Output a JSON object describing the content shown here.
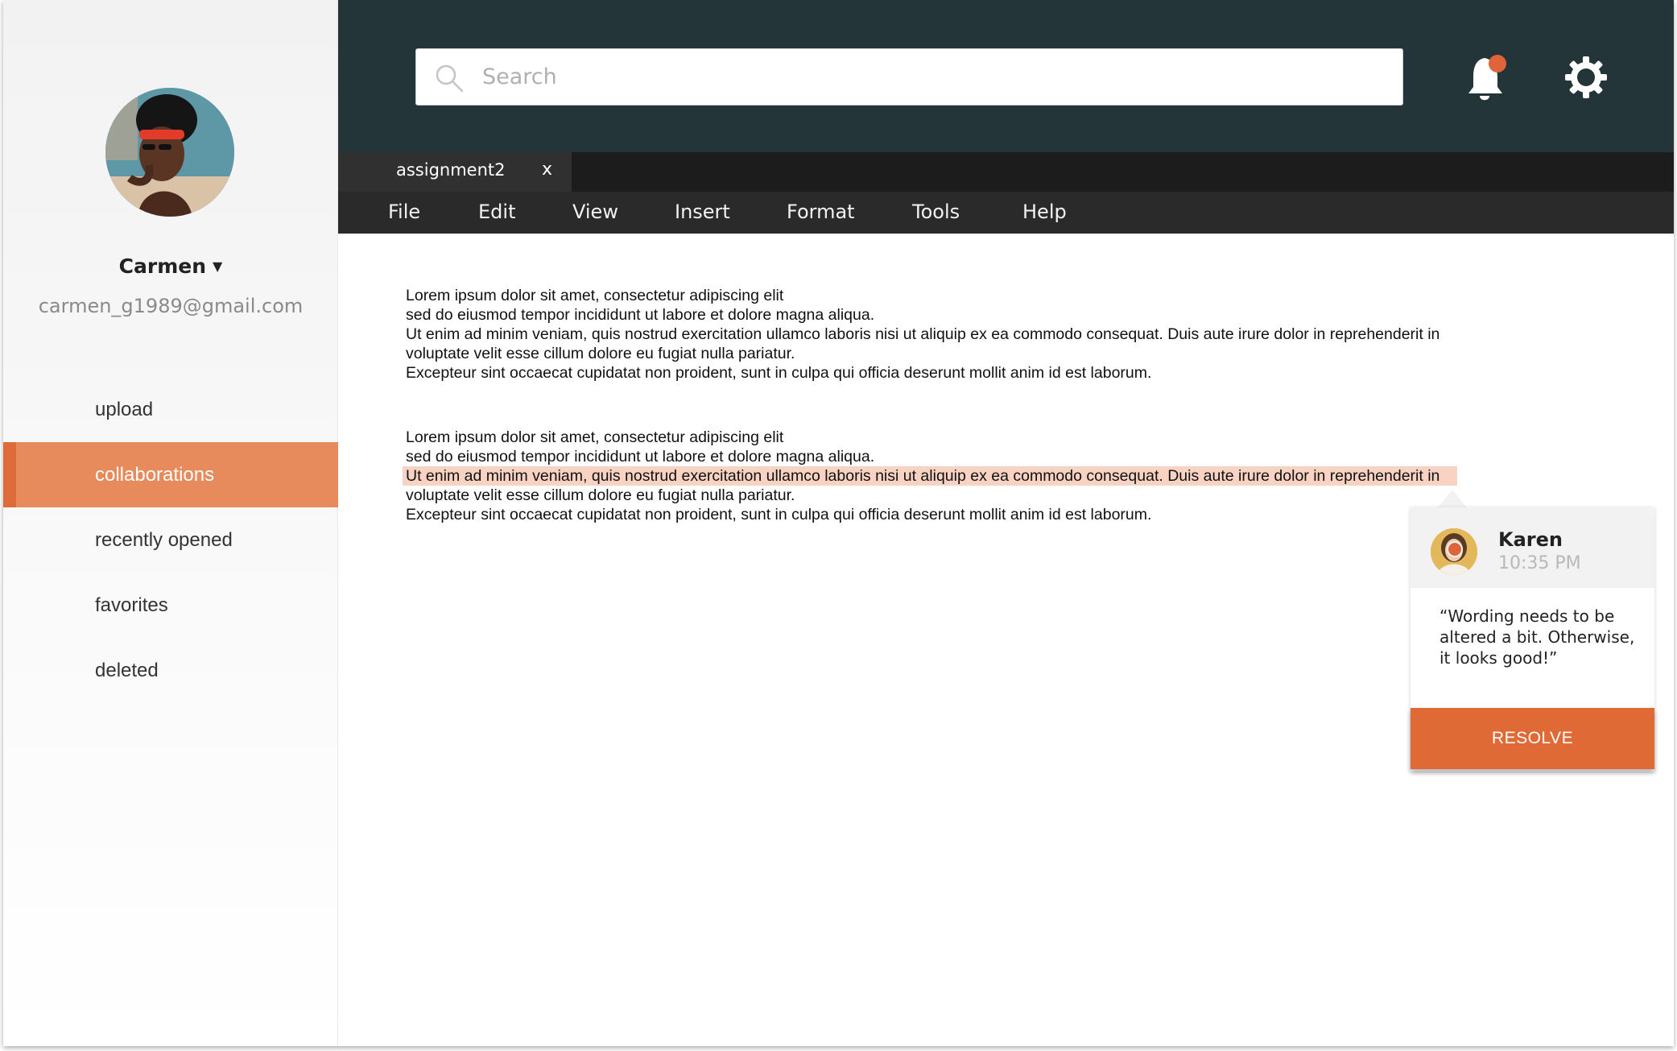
{
  "user": {
    "name": "Carmen",
    "caret": "▼",
    "email": "carmen_g1989@gmail.com"
  },
  "sidebar": {
    "items": [
      {
        "label": "upload",
        "active": false
      },
      {
        "label": "collaborations",
        "active": true
      },
      {
        "label": "recently opened",
        "active": false
      },
      {
        "label": "favorites",
        "active": false
      },
      {
        "label": "deleted",
        "active": false
      }
    ]
  },
  "search": {
    "placeholder": "Search",
    "value": ""
  },
  "icons": {
    "search": "search-icon",
    "notifications": "bell-icon",
    "settings": "gear-icon"
  },
  "tabs": [
    {
      "label": "assignment2",
      "close": "x"
    }
  ],
  "menu": [
    "File",
    "Edit",
    "View",
    "Insert",
    "Format",
    "Tools",
    "Help"
  ],
  "document": {
    "paragraphs": [
      [
        "Lorem ipsum dolor sit amet, consectetur adipiscing elit",
        "sed do eiusmod tempor incididunt ut labore et dolore magna aliqua.",
        "Ut enim ad minim veniam, quis nostrud exercitation ullamco laboris nisi ut aliquip ex ea commodo consequat. Duis aute irure dolor in reprehenderit in",
        "voluptate velit esse cillum dolore eu fugiat nulla pariatur.",
        "Excepteur sint occaecat cupidatat non proident, sunt in culpa qui officia deserunt mollit anim id est laborum."
      ],
      [
        "Lorem ipsum dolor sit amet, consectetur adipiscing elit",
        "sed do eiusmod tempor incididunt ut labore et dolore magna aliqua.",
        "Ut enim ad minim veniam, quis nostrud exercitation ullamco laboris nisi ut aliquip ex ea commodo consequat. Duis aute irure dolor in reprehenderit in",
        "voluptate velit esse cillum dolore eu fugiat nulla pariatur.",
        "Excepteur sint occaecat cupidatat non proident, sunt in culpa qui officia deserunt mollit anim id est laborum."
      ]
    ]
  },
  "comment": {
    "author": "Karen",
    "time": "10:35 PM",
    "text": "“Wording needs to be altered a bit. Otherwise, it looks good!”",
    "action": "RESOLVE"
  },
  "colors": {
    "accent": "#e06a36",
    "sidebar_active": "#e78b5c",
    "topbar": "#233538",
    "highlight": "#f8d3c3"
  }
}
